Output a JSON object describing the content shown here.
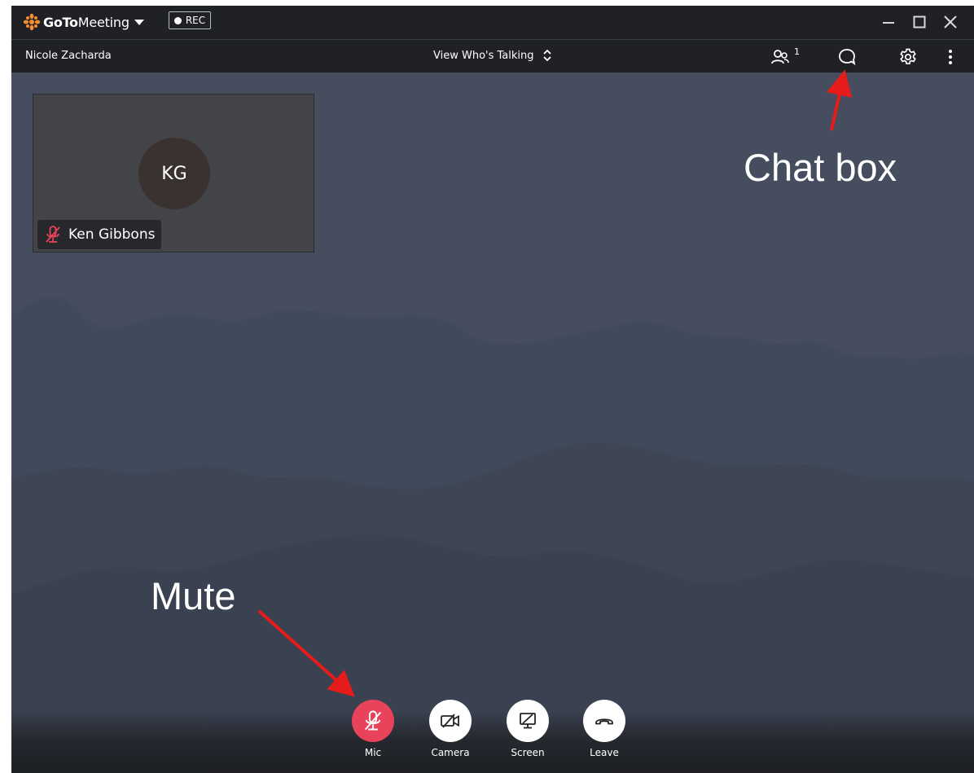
{
  "app": {
    "logo_goto": "GoTo",
    "logo_meeting": "Meeting",
    "rec_label": "REC"
  },
  "toolbar": {
    "organizer_name": "Nicole Zacharda",
    "view_label": "View Who's Talking",
    "participants_count": "1"
  },
  "participant": {
    "initials": "KG",
    "name": "Ken Gibbons"
  },
  "annotations": {
    "chat_label": "Chat box",
    "mute_label": "Mute"
  },
  "controls": [
    {
      "label": "Mic",
      "state": "muted"
    },
    {
      "label": "Camera",
      "state": "off"
    },
    {
      "label": "Screen",
      "state": "off"
    },
    {
      "label": "Leave",
      "state": "normal"
    }
  ],
  "colors": {
    "brand_orange": "#f68d2e",
    "muted_red": "#e8435a",
    "annotation_arrow": "#e81b1b",
    "stage_bg": "#454d5f",
    "bar_bg": "#1f2124"
  }
}
